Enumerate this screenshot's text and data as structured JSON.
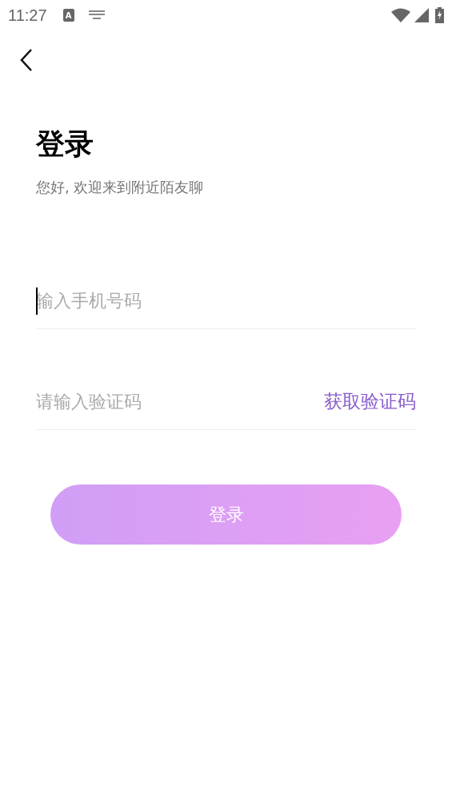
{
  "status_bar": {
    "time": "11:27",
    "input_method_letter": "A"
  },
  "title": "登录",
  "subtitle": "您好, 欢迎来到附近陌友聊",
  "phone_field": {
    "placeholder": "输入手机号码",
    "focused": true
  },
  "code_field": {
    "placeholder": "请输入验证码",
    "action": "获取验证码"
  },
  "login_button": {
    "label": "登录"
  }
}
